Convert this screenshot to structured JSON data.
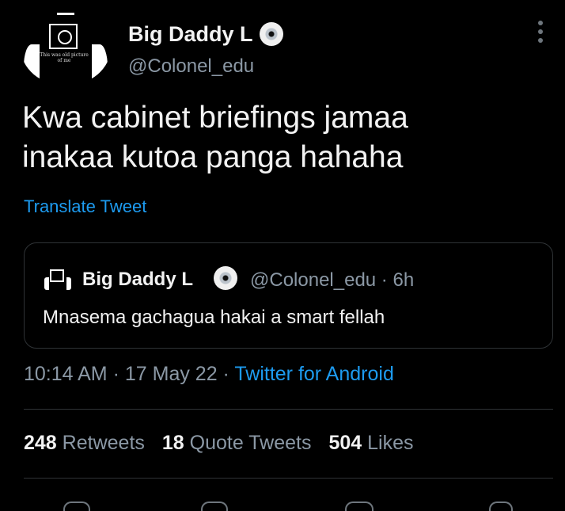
{
  "header": {
    "display_name": "Big Daddy L",
    "handle": "@Colonel_edu",
    "avatar_caption": "This was old picture of me"
  },
  "tweet": {
    "text_line1": "Kwa cabinet briefings jamaa",
    "text_line2": "inakaa kutoa panga hahaha",
    "translate_label": "Translate Tweet"
  },
  "quoted": {
    "display_name": "Big Daddy L",
    "handle": "@Colonel_edu",
    "age": "6h",
    "text": "Mnasema gachagua hakai a smart fellah"
  },
  "meta": {
    "time": "10:14 AM",
    "date": "17 May 22",
    "source": "Twitter for Android"
  },
  "stats": {
    "retweets_count": "248",
    "retweets_label": "Retweets",
    "quotes_count": "18",
    "quotes_label": "Quote Tweets",
    "likes_count": "504",
    "likes_label": "Likes"
  },
  "colors": {
    "background": "#000000",
    "link": "#1d9bf0",
    "secondary_text": "#8b98a5",
    "divider": "#2f3336"
  },
  "icons": [
    "avatar",
    "cd-badge-icon",
    "more-options-icon",
    "reply-icon",
    "retweet-icon",
    "like-icon",
    "share-icon"
  ]
}
